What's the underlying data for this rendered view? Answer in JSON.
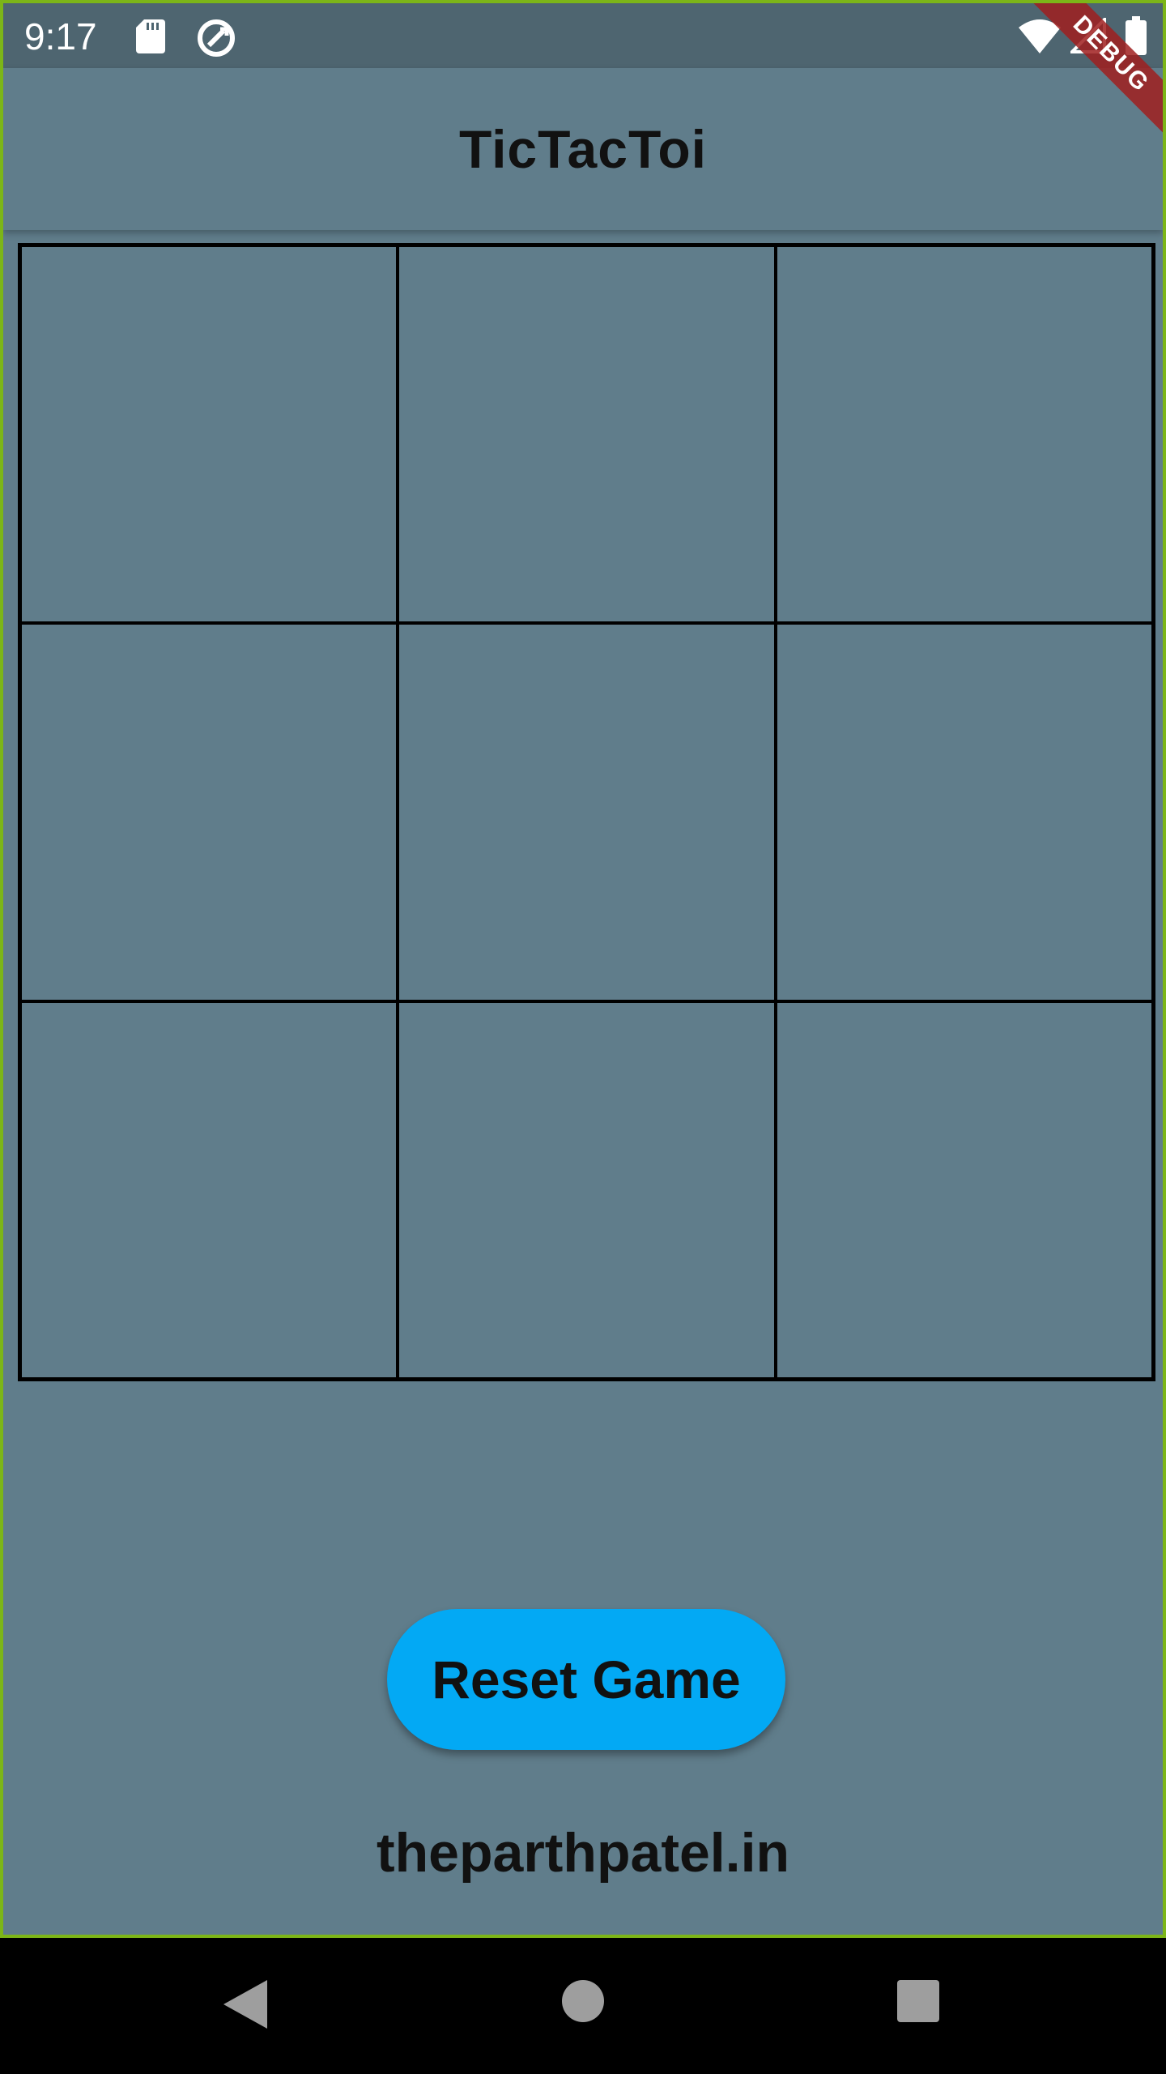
{
  "status_bar": {
    "time": "9:17",
    "icons": [
      "sd-card-icon",
      "sync-icon",
      "wifi-icon",
      "signal-icon",
      "battery-icon"
    ]
  },
  "debug_banner": "DEBUG",
  "app_bar": {
    "title": "TicTacToi"
  },
  "board": {
    "cells": [
      "",
      "",
      "",
      "",
      "",
      "",
      "",
      "",
      ""
    ]
  },
  "reset_button": {
    "label": "Reset Game"
  },
  "footer": {
    "text": "theparthpatel.in"
  },
  "nav_bar": {
    "icons": [
      "back-icon",
      "home-icon",
      "recent-apps-icon"
    ]
  },
  "colors": {
    "background": "#607d8b",
    "status_bar": "#4e6570",
    "button": "#03a9f4",
    "debug_banner": "#a01e1e",
    "frame_border": "#7cb518"
  }
}
